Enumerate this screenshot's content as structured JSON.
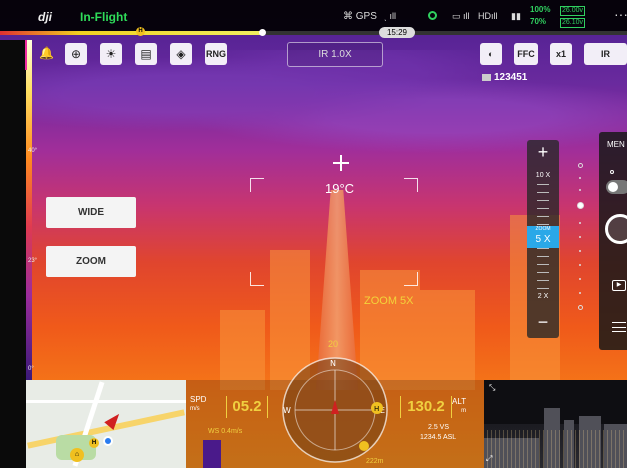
{
  "topbar": {
    "logo": "dji",
    "flight_status": "In-Flight",
    "gps_label": "GPS",
    "signal_labels": [
      "ıll",
      "ıll",
      "HDıll"
    ],
    "flight_time": "15:29",
    "battery": [
      {
        "percent": "100%",
        "voltage": "26.00v"
      },
      {
        "percent": "70%",
        "voltage": "26.10v"
      }
    ],
    "more_label": "···",
    "home_marker": "H"
  },
  "toolbar": {
    "rng_label": "RNG"
  },
  "camera": {
    "mode_label": "IR 1.0X",
    "ffc_label": "FFC",
    "zoom_x1_label": "x1",
    "ir_label": "IR",
    "sd_card_id": "123451"
  },
  "thermal": {
    "spot_temp": "19°C",
    "zoom_overlay": "ZOOM 5X",
    "scale_ticks": [
      "40°",
      "23°",
      "0°"
    ]
  },
  "side_buttons": {
    "wide": "WIDE",
    "zoom": "ZOOM"
  },
  "zoom_panel": {
    "plus": "+",
    "minus": "−",
    "top_label": "10 X",
    "bottom_label": "2 X",
    "current_small": "ZOOM",
    "current_value": "5 X"
  },
  "right_panel": {
    "menu_label": "MEN"
  },
  "telemetry": {
    "spd_label": "SPD",
    "spd_unit": "m/s",
    "spd_value": "05.2",
    "wind": "WS 0.4m/s",
    "alt_label": "ALT",
    "alt_unit": "m",
    "alt_value": "130.2",
    "vs": "2.5 VS",
    "asl": "1234.5 ASL",
    "heading": "20",
    "home_distance": "222m"
  },
  "colors": {
    "accent_green": "#2fdc5a",
    "accent_yellow": "#f0d040",
    "zoom_blue": "#2aa8e8"
  }
}
